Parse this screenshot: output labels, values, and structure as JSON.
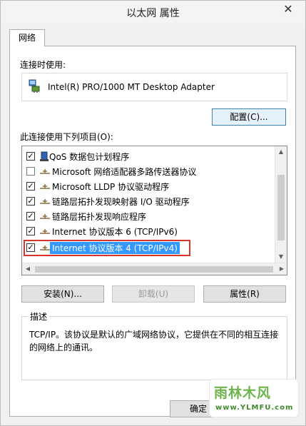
{
  "window": {
    "title": "以太网 属性",
    "close_glyph": "✕"
  },
  "tabs": [
    {
      "label": "网络"
    }
  ],
  "connect_using": {
    "label": "连接时使用:",
    "adapter_name": "Intel(R) PRO/1000 MT Desktop Adapter",
    "configure_button": "配置(C)..."
  },
  "items_section": {
    "label": "此连接使用下列项目(O):",
    "items": [
      {
        "label": "QoS 数据包计划程序",
        "checked": true,
        "icon": "qos-scheduler-icon"
      },
      {
        "label": "Microsoft 网络适配器多路传送器协议",
        "checked": false,
        "icon": "protocol-icon"
      },
      {
        "label": "Microsoft LLDP 协议驱动程序",
        "checked": true,
        "icon": "protocol-icon"
      },
      {
        "label": "链路层拓扑发现映射器 I/O 驱动程序",
        "checked": true,
        "icon": "protocol-icon"
      },
      {
        "label": "链路层拓扑发现响应程序",
        "checked": true,
        "icon": "protocol-icon"
      },
      {
        "label": "Internet 协议版本 6 (TCP/IPv6)",
        "checked": true,
        "icon": "protocol-icon"
      },
      {
        "label": "Internet 协议版本 4 (TCP/IPv4)",
        "checked": true,
        "icon": "protocol-icon",
        "selected": true
      }
    ],
    "check_glyph": "✓"
  },
  "buttons": {
    "install": "安装(N)...",
    "uninstall": "卸载(U)",
    "properties": "属性(R)"
  },
  "description": {
    "title": "描述",
    "text": "TCP/IP。该协议是默认的广域网络协议，它提供在不同的相互连接的网络上的通讯。"
  },
  "footer": {
    "ok_button": "确定"
  },
  "watermark": {
    "logo": "雨林木风",
    "url": "www.YLMFU.com"
  },
  "colors": {
    "selection": "#3399ff",
    "highlight_box": "#d9342b",
    "watermark": "#6bb34a"
  }
}
